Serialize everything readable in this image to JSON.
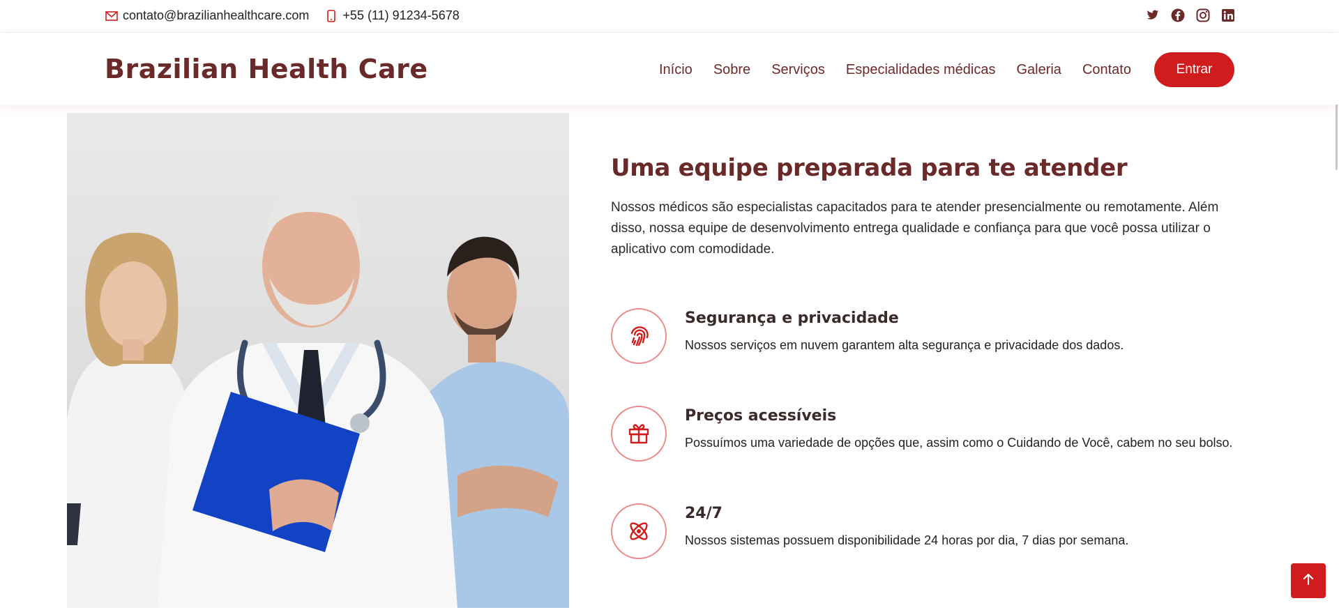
{
  "topbar": {
    "email": "contato@brazilianhealthcare.com",
    "phone": "+55 (11) 91234-5678",
    "email_icon": "envelope-icon",
    "phone_icon": "phone-icon",
    "social": [
      "twitter-icon",
      "facebook-icon",
      "instagram-icon",
      "linkedin-icon"
    ]
  },
  "header": {
    "brand": "Brazilian Health Care",
    "nav": [
      "Início",
      "Sobre",
      "Serviços",
      "Especialidades médicas",
      "Galeria",
      "Contato"
    ],
    "cta": "Entrar"
  },
  "main": {
    "title": "Uma equipe preparada para te atender",
    "lead": "Nossos médicos são especialistas capacitados para te atender presencialmente ou remotamente. Além disso, nossa equipe de desenvolvimento entrega qualidade e confiança para que você possa utilizar o aplicativo com comodidade.",
    "features": [
      {
        "icon": "fingerprint-icon",
        "title": "Segurança e privacidade",
        "desc": "Nossos serviços em nuvem garantem alta segurança e privacidade dos dados."
      },
      {
        "icon": "gift-icon",
        "title": "Preços acessíveis",
        "desc": "Possuímos uma variedade de opções que, assim como o Cuidando de Você, cabem no seu bolso."
      },
      {
        "icon": "atom-icon",
        "title": "24/7",
        "desc": "Nossos sistemas possuem disponibilidade 24 horas por dia, 7 dias por semana."
      }
    ]
  },
  "colors": {
    "accent": "#d01c1c",
    "brand": "#6a2a2a",
    "circle_border": "#eb8a8a"
  },
  "back_to_top_icon": "arrow-up-icon"
}
